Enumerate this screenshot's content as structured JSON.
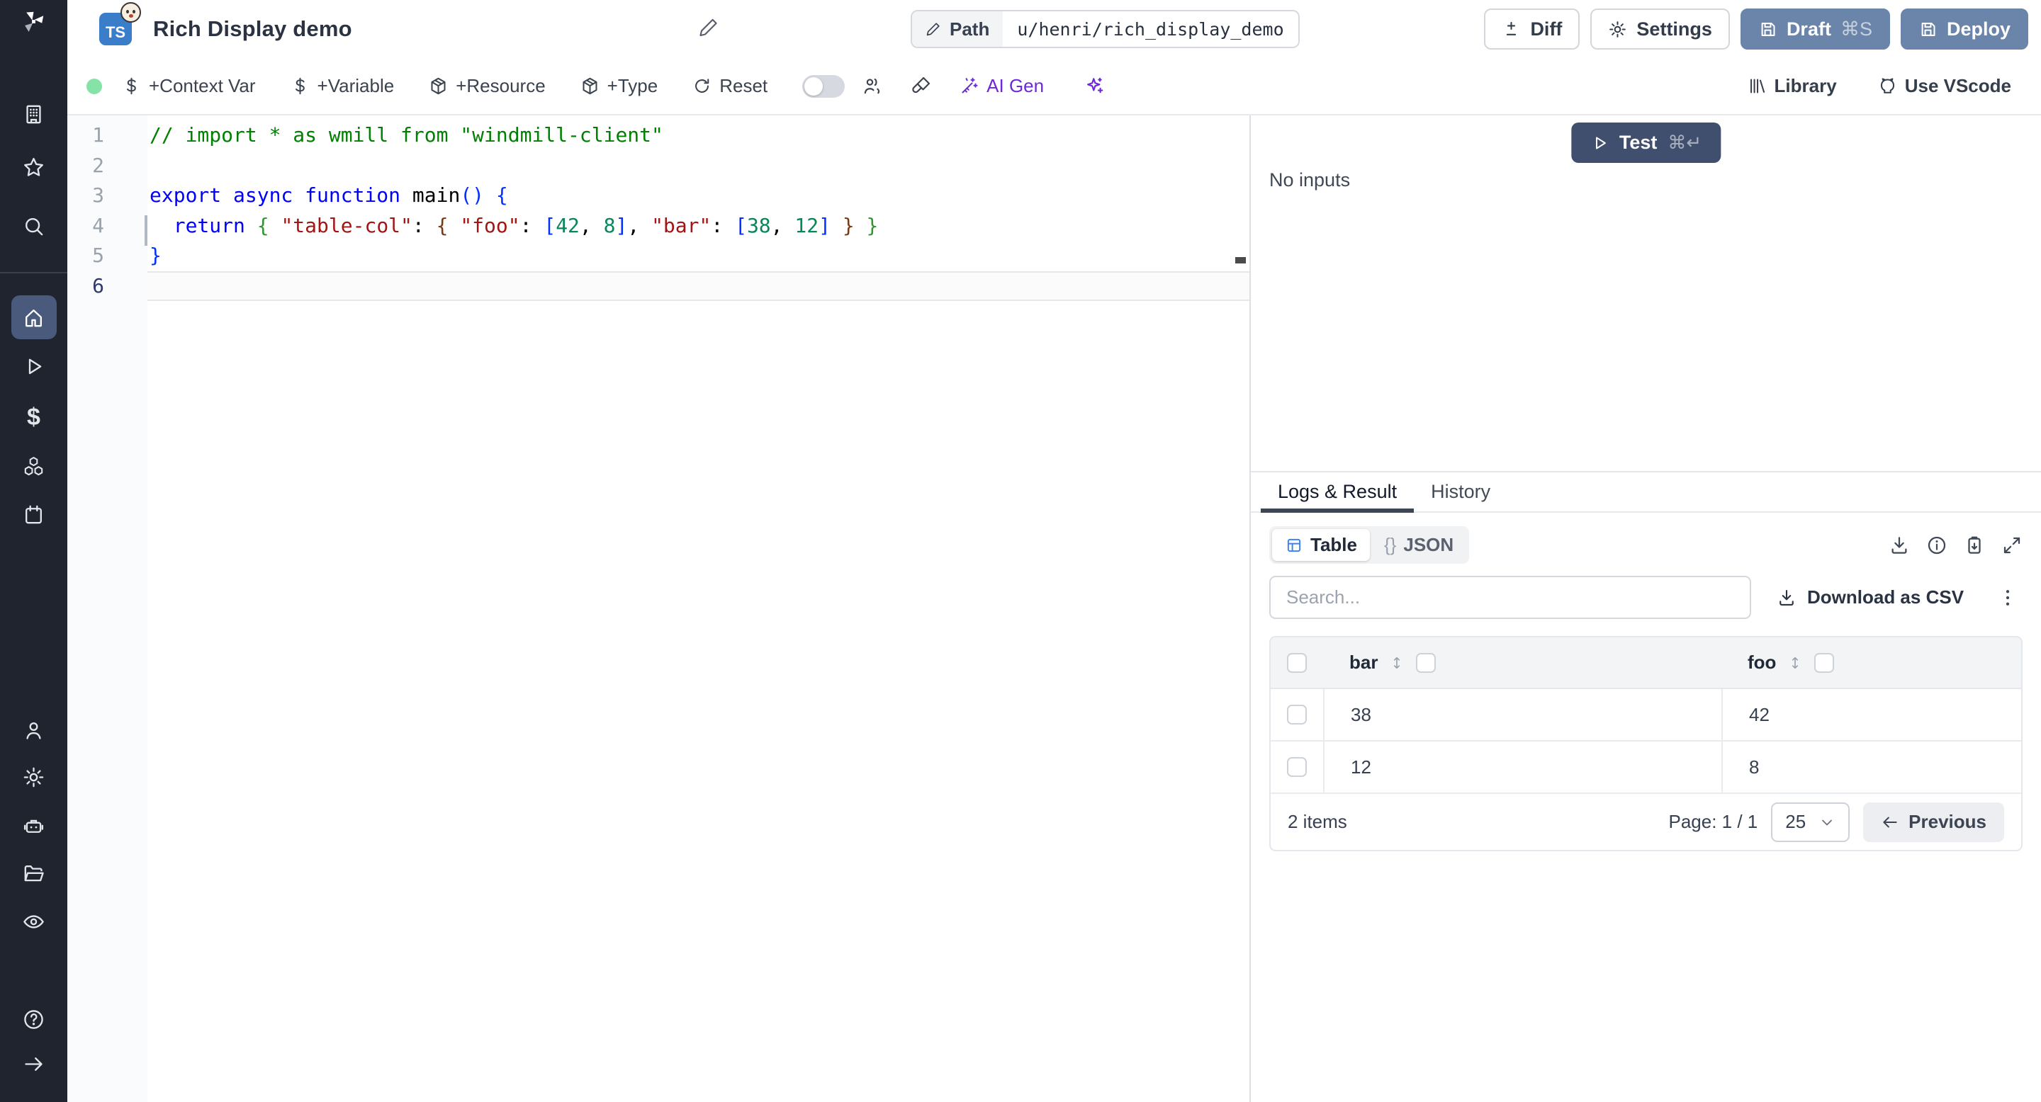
{
  "header": {
    "badge": "TS",
    "title": "Rich Display demo",
    "path_label": "Path",
    "path_value": "u/henri/rich_display_demo",
    "diff": "Diff",
    "settings": "Settings",
    "draft": "Draft",
    "draft_shortcut": "⌘S",
    "deploy": "Deploy"
  },
  "toolbar": {
    "context_var": "+Context Var",
    "variable": "+Variable",
    "resource": "+Resource",
    "type": "+Type",
    "reset": "Reset",
    "ai_gen": "AI Gen",
    "library": "Library",
    "use_vscode": "Use VScode"
  },
  "editor": {
    "active_line": 6,
    "syntax_colors": {
      "comment": "#008000",
      "keyword": "#0000ff",
      "string": "#a31515",
      "number": "#098658",
      "bracket1": "#0431fa",
      "bracket2": "#319331",
      "bracket3": "#7b3814",
      "plain": "#000000"
    },
    "lines": [
      {
        "n": 1,
        "tokens": [
          [
            "// import * as wmill from \"windmill-client\"",
            "comment"
          ]
        ]
      },
      {
        "n": 2,
        "tokens": []
      },
      {
        "n": 3,
        "tokens": [
          [
            "export async function ",
            "keyword"
          ],
          [
            "main",
            "plain"
          ],
          [
            "() {",
            "bracket1"
          ]
        ]
      },
      {
        "n": 4,
        "tokens": [
          [
            "  ",
            "plain"
          ],
          [
            "return",
            "keyword"
          ],
          [
            " ",
            "plain"
          ],
          [
            "{",
            "bracket2"
          ],
          [
            " ",
            "plain"
          ],
          [
            "\"table-col\"",
            "string"
          ],
          [
            ": ",
            "plain"
          ],
          [
            "{",
            "bracket3"
          ],
          [
            " ",
            "plain"
          ],
          [
            "\"foo\"",
            "string"
          ],
          [
            ": ",
            "plain"
          ],
          [
            "[",
            "bracket1"
          ],
          [
            "42",
            "number"
          ],
          [
            ", ",
            "plain"
          ],
          [
            "8",
            "number"
          ],
          [
            "]",
            "bracket1"
          ],
          [
            ", ",
            "plain"
          ],
          [
            "\"bar\"",
            "string"
          ],
          [
            ": ",
            "plain"
          ],
          [
            "[",
            "bracket1"
          ],
          [
            "38",
            "number"
          ],
          [
            ", ",
            "plain"
          ],
          [
            "12",
            "number"
          ],
          [
            "]",
            "bracket1"
          ],
          [
            " ",
            "plain"
          ],
          [
            "}",
            "bracket3"
          ],
          [
            " ",
            "plain"
          ],
          [
            "}",
            "bracket2"
          ]
        ]
      },
      {
        "n": 5,
        "tokens": [
          [
            "}",
            "bracket1"
          ]
        ]
      },
      {
        "n": 6,
        "tokens": []
      }
    ]
  },
  "run_panel": {
    "test": "Test",
    "test_shortcut": "⌘↵",
    "no_inputs": "No inputs"
  },
  "result_panel": {
    "tabs": [
      {
        "label": "Logs & Result",
        "active": true
      },
      {
        "label": "History",
        "active": false
      }
    ],
    "views": [
      {
        "label": "Table",
        "active": true
      },
      {
        "label": "JSON",
        "prefix": "{}",
        "active": false
      }
    ],
    "search_placeholder": "Search...",
    "download_csv": "Download as CSV",
    "table": {
      "columns": [
        "bar",
        "foo"
      ],
      "rows": [
        [
          "38",
          "42"
        ],
        [
          "12",
          "8"
        ]
      ],
      "items_label": "2 items",
      "page_label": "Page: 1 / 1",
      "page_size": "25",
      "previous": "Previous"
    }
  },
  "colors": {
    "sidebar_bg": "#1F242E",
    "sidebar_active_bg": "#4A5A7C",
    "primary_button": "#6B84AA",
    "test_button": "#404F6E",
    "ai_purple": "#6D28D9",
    "table_icon_blue": "#3B82F6",
    "status_dot_green": "#86E3A8",
    "ts_badge_blue": "#3A7DC9",
    "active_tab_underline": "#3D4654"
  },
  "icons": {
    "sidebar": [
      "windmill-logo",
      "building",
      "star",
      "search",
      "home",
      "play",
      "dollar",
      "cubes",
      "calendar",
      "user",
      "gear",
      "robot",
      "folder",
      "eye",
      "help-circle",
      "arrow-right"
    ],
    "header": [
      "pencil",
      "plus-minus-diff",
      "gear",
      "save-floppy"
    ],
    "toolbar": [
      "dollar",
      "package-box",
      "refresh",
      "toggle",
      "multiplayer-users",
      "brush",
      "wand",
      "sparkles",
      "library-bars",
      "octocat"
    ],
    "results": [
      "table-grid",
      "curly-braces",
      "download",
      "info-circle",
      "clipboard-copy",
      "expand",
      "kebab-menu",
      "sort-arrows",
      "chevron-down",
      "arrow-left"
    ]
  }
}
